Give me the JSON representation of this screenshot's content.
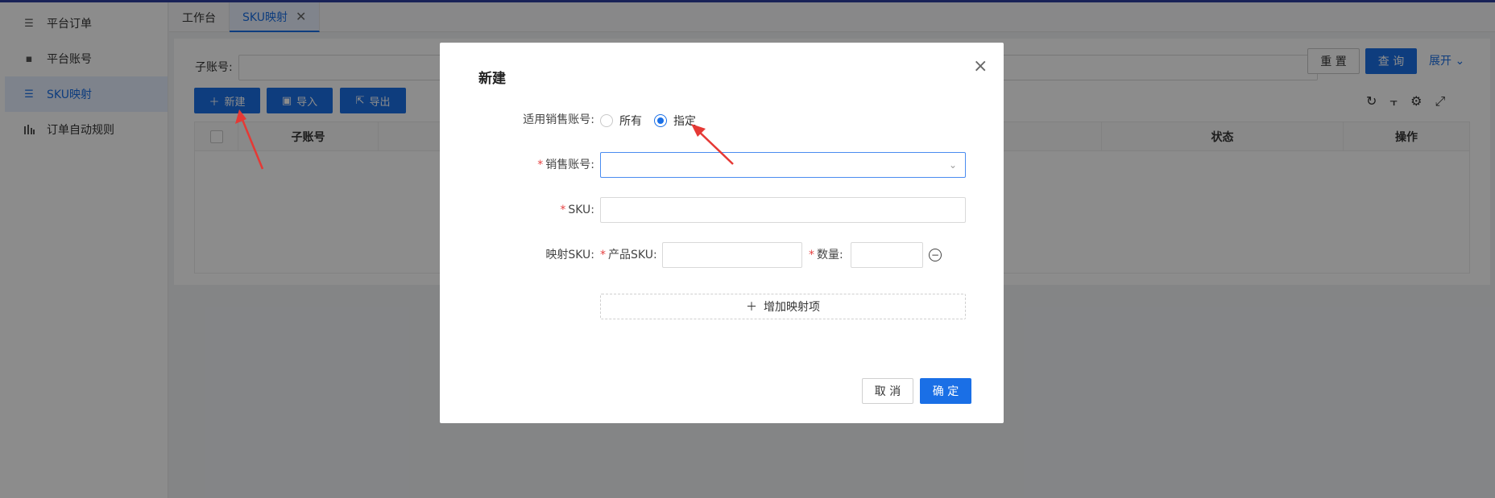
{
  "sidebar": {
    "items": [
      {
        "label": "平台订单",
        "icon": "list-icon"
      },
      {
        "label": "平台账号",
        "icon": "card-icon"
      },
      {
        "label": "SKU映射",
        "icon": "list-icon",
        "active": true
      },
      {
        "label": "订单自动规则",
        "icon": "bars-icon"
      }
    ]
  },
  "tabs": [
    {
      "label": "工作台"
    },
    {
      "label": "SKU映射",
      "active": true,
      "close": "✕"
    }
  ],
  "filter": {
    "subaccount_label": "子账号:",
    "reset_label": "重 置",
    "query_label": "查 询",
    "expand_label": "展开"
  },
  "toolbar": {
    "new_label": "新建",
    "import_label": "导入",
    "export_label": "导出"
  },
  "table": {
    "columns": [
      "子账号",
      "状态",
      "操作"
    ]
  },
  "modal": {
    "title": "新建",
    "account_scope_label": "适用销售账号:",
    "radio_all": "所有",
    "radio_specified": "指定",
    "radio_selected": "指定",
    "sales_account_label": "销售账号:",
    "sku_label": "SKU:",
    "mapping_label": "映射SKU:",
    "product_sku_label": "产品SKU:",
    "quantity_label": "数量:",
    "add_mapping_label": "增加映射项",
    "cancel_label": "取 消",
    "ok_label": "确 定"
  },
  "colors": {
    "primary": "#1a6fe6",
    "required": "#e64242",
    "annotation": "#e53935"
  }
}
